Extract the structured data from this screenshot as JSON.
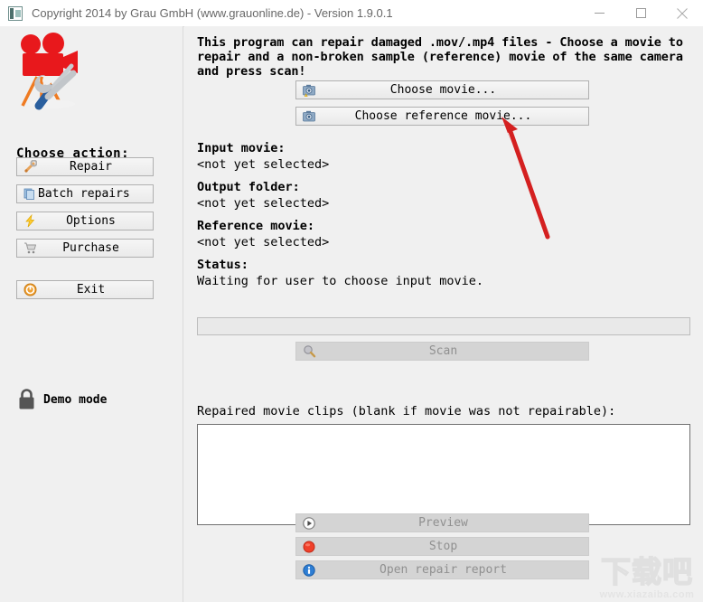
{
  "window": {
    "title": "Copyright 2014 by Grau GmbH (www.grauonline.de) - Version 1.9.0.1",
    "icon": "app-icon",
    "controls": {
      "minimize": "minimize-icon",
      "maximize": "maximize-icon",
      "close": "close-icon"
    }
  },
  "sidebar": {
    "logo": "movie-camera-repair-icon",
    "heading": "Choose action:",
    "buttons": [
      {
        "label": "Repair",
        "icon": "wrench-screwdriver-icon"
      },
      {
        "label": "Batch repairs",
        "icon": "multiple-documents-icon"
      },
      {
        "label": "Options",
        "icon": "lightning-bolt-icon"
      },
      {
        "label": "Purchase",
        "icon": "shopping-cart-icon"
      },
      {
        "label": "Exit",
        "icon": "power-icon"
      }
    ],
    "status": {
      "icon": "padlock-icon",
      "label": "Demo mode"
    }
  },
  "main": {
    "intro": "This program can repair damaged .mov/.mp4 files - Choose a movie to repair and a non-broken sample (reference) movie of the same camera and press scan!",
    "choose_buttons": [
      {
        "label": "Choose movie...",
        "icon": "camera-warning-icon",
        "enabled": true
      },
      {
        "label": "Choose reference movie...",
        "icon": "camera-icon",
        "enabled": true
      }
    ],
    "fields": [
      {
        "label": "Input movie:",
        "value": "<not yet selected>"
      },
      {
        "label": "Output folder:",
        "value": "<not yet selected>"
      },
      {
        "label": "Reference movie:",
        "value": "<not yet selected>"
      },
      {
        "label": "Status:",
        "value": "Waiting for user to choose input movie."
      }
    ],
    "progress": {
      "value": 0,
      "max": 100
    },
    "scan_button": {
      "label": "Scan",
      "icon": "magnifier-icon",
      "enabled": false
    },
    "clips_label": "Repaired movie clips (blank if movie was not repairable):",
    "clips_value": "",
    "bottom_buttons": [
      {
        "label": "Preview",
        "icon": "play-icon",
        "enabled": false
      },
      {
        "label": "Stop",
        "icon": "stop-circle-icon",
        "enabled": false
      },
      {
        "label": "Open repair report",
        "icon": "info-icon",
        "enabled": false
      }
    ]
  },
  "annotation": {
    "arrow": "red-arrow-pointer",
    "color": "#d42020"
  },
  "watermark": {
    "text_cn": "下载吧",
    "url": "www.xiazaiba.com"
  }
}
